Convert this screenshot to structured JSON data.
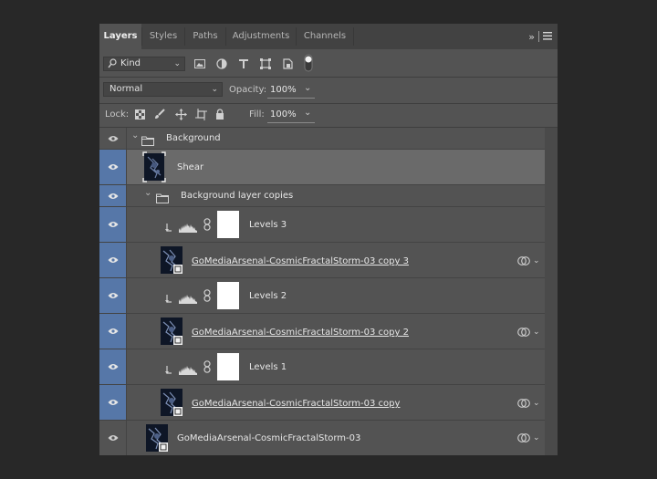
{
  "tabs": [
    {
      "label": "Layers",
      "active": true
    },
    {
      "label": "Styles",
      "active": false
    },
    {
      "label": "Paths",
      "active": false
    },
    {
      "label": "Adjustments",
      "active": false
    },
    {
      "label": "Channels",
      "active": false
    }
  ],
  "tabbar_icons": {
    "collapse": "double-chevron-right-icon",
    "menu": "hamburger-menu-icon"
  },
  "filter": {
    "kind_label": "Kind",
    "icons": [
      "search-icon",
      "image-filter-icon",
      "adjustment-filter-icon",
      "type-filter-icon",
      "shape-filter-icon",
      "smart-object-filter-icon",
      "toggle-filter-icon"
    ]
  },
  "blend": {
    "mode": "Normal",
    "opacity_label": "Opacity:",
    "opacity_value": "100%"
  },
  "lock": {
    "label": "Lock:",
    "fill_label": "Fill:",
    "fill_value": "100%",
    "icons": [
      "lock-transparent-icon",
      "lock-brush-icon",
      "lock-move-icon",
      "lock-artboard-icon",
      "lock-all-icon"
    ]
  },
  "layers": [
    {
      "name": "Background",
      "kind": "group"
    },
    {
      "name": "Shear",
      "kind": "smart"
    },
    {
      "name": "Background layer copies",
      "kind": "group"
    },
    {
      "name": "Levels 3",
      "kind": "adjustment"
    },
    {
      "name": "GoMediaArsenal-CosmicFractalStorm-03 copy 3",
      "kind": "smart"
    },
    {
      "name": "Levels 2",
      "kind": "adjustment"
    },
    {
      "name": "GoMediaArsenal-CosmicFractalStorm-03 copy 2",
      "kind": "smart"
    },
    {
      "name": "Levels 1",
      "kind": "adjustment"
    },
    {
      "name": "GoMediaArsenal-CosmicFractalStorm-03 copy",
      "kind": "smart"
    },
    {
      "name": "GoMediaArsenal-CosmicFractalStorm-03",
      "kind": "smart"
    }
  ],
  "colors": {
    "panel": "#535353",
    "tabbar": "#424242",
    "selected": "#6a6a6a",
    "eye_highlight": "#5677a8"
  }
}
